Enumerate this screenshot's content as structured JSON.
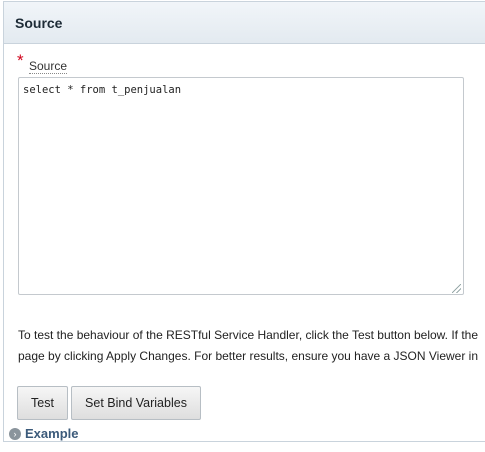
{
  "region": {
    "title": "Source"
  },
  "source_field": {
    "required_marker": "*",
    "label": "Source",
    "value": "select * from t_penjualan"
  },
  "help": {
    "line1": "To test the behaviour of the RESTful Service Handler, click the Test button below. If the",
    "line2": "page by clicking Apply Changes. For better results, ensure you have a JSON Viewer in"
  },
  "buttons": {
    "test": "Test",
    "set_bind_variables": "Set Bind Variables"
  },
  "example": {
    "icon": "expand-arrow-icon",
    "label": "Example"
  }
}
